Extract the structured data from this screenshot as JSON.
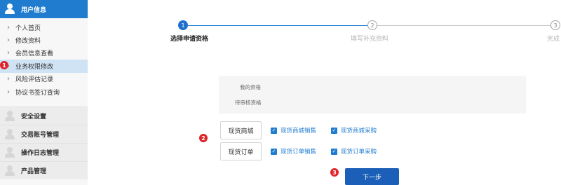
{
  "sidebar": {
    "sections": [
      {
        "label": "用户信息"
      },
      {
        "label": "安全设置"
      },
      {
        "label": "交易账号管理"
      },
      {
        "label": "操作日志管理"
      },
      {
        "label": "产品管理"
      }
    ],
    "items": [
      {
        "label": "个人首页"
      },
      {
        "label": "修改资料"
      },
      {
        "label": "会员信息查看"
      },
      {
        "label": "业务权限修改"
      },
      {
        "label": "风险评估记录"
      },
      {
        "label": "协议书签订查询"
      }
    ],
    "item_arrow": "›",
    "selected_item": "业务权限修改"
  },
  "stepper": {
    "steps": [
      {
        "number": "1",
        "label": "选择申请资格"
      },
      {
        "number": "2",
        "label": "填写补充资料"
      },
      {
        "number": "3",
        "label": "完成"
      }
    ]
  },
  "qualification": {
    "my_label": "我的资格",
    "pending_label": "待审核资格"
  },
  "markets": [
    {
      "category": "现货商城",
      "options": [
        "现货商城销售",
        "现货商城采购"
      ]
    },
    {
      "category": "现货订单",
      "options": [
        "现货订单销售",
        "现货订单采购"
      ]
    }
  ],
  "next_button": "下一步",
  "badges": {
    "one": "1",
    "two": "2",
    "three": "3"
  },
  "colors": {
    "accent": "#1f7ccf",
    "badge": "#e0242a",
    "button": "#1b5fb8"
  },
  "icons": {
    "section": "user-icon",
    "checkbox": "checkbox-checked-icon",
    "item": "chevron-right-icon"
  }
}
